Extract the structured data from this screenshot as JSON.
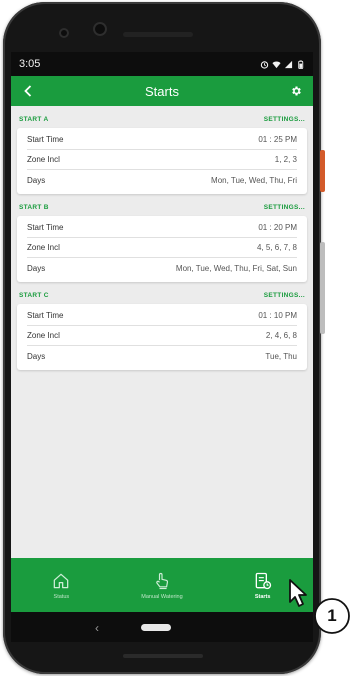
{
  "status_bar": {
    "time": "3:05"
  },
  "app_bar": {
    "title": "Starts",
    "back_icon": "chevron-left-icon",
    "settings_icon": "gear-icon"
  },
  "sections": [
    {
      "name": "START A",
      "settings": "SETTINGS...",
      "rows": [
        {
          "label": "Start Time",
          "value": "01 : 25 PM"
        },
        {
          "label": "Zone Incl",
          "value": "1, 2, 3"
        },
        {
          "label": "Days",
          "value": "Mon, Tue, Wed, Thu, Fri"
        }
      ]
    },
    {
      "name": "START B",
      "settings": "SETTINGS...",
      "rows": [
        {
          "label": "Start Time",
          "value": "01 : 20 PM"
        },
        {
          "label": "Zone Incl",
          "value": "4, 5, 6, 7, 8"
        },
        {
          "label": "Days",
          "value": "Mon, Tue, Wed, Thu, Fri, Sat, Sun"
        }
      ]
    },
    {
      "name": "START C",
      "settings": "SETTINGS...",
      "rows": [
        {
          "label": "Start Time",
          "value": "01 : 10 PM"
        },
        {
          "label": "Zone Incl",
          "value": "2, 4, 6, 8"
        },
        {
          "label": "Days",
          "value": "Tue, Thu"
        }
      ]
    }
  ],
  "bottom_nav": [
    {
      "label": "Status",
      "icon": "home-icon",
      "active": false
    },
    {
      "label": "Manual Watering",
      "icon": "hand-pointer-icon",
      "active": false
    },
    {
      "label": "Starts",
      "icon": "starts-schedule-icon",
      "active": true
    }
  ],
  "callout": {
    "number": "1"
  },
  "colors": {
    "primary": "#1a9c3e",
    "background": "#ececec",
    "phone_body": "#161616"
  }
}
